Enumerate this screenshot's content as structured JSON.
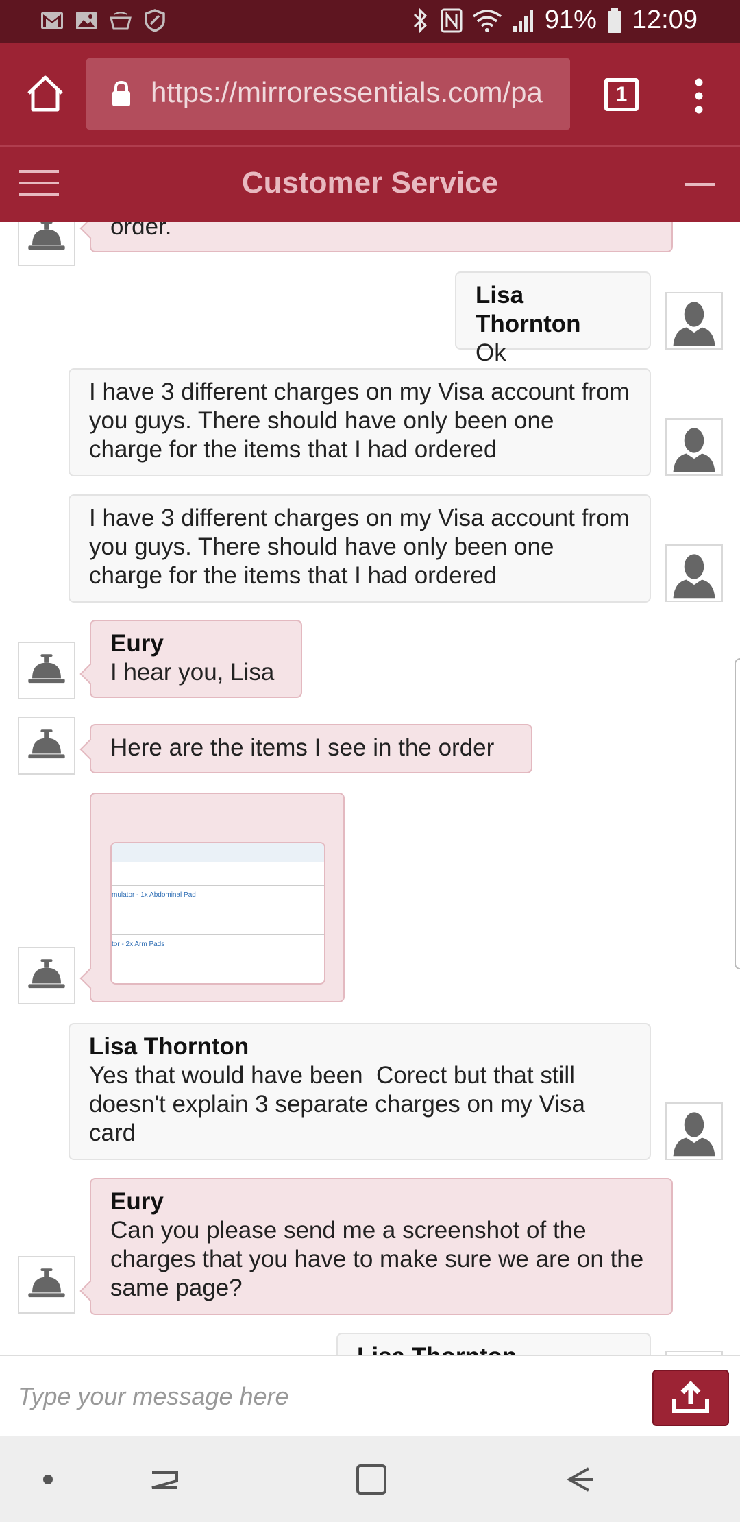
{
  "status_bar": {
    "left_icons": [
      "gmail-icon",
      "image-icon",
      "amazon-icon",
      "shield-icon"
    ],
    "right_icons": [
      "bluetooth-icon",
      "nfc-icon",
      "wifi-icon",
      "signal-icon"
    ],
    "battery": "91%",
    "time": "12:09"
  },
  "browser": {
    "url": "https://mirroressentials.com/pa",
    "tab_count": "1"
  },
  "header": {
    "title": "Customer Service"
  },
  "messages": [
    {
      "from": "agent",
      "sender": "",
      "text": "order."
    },
    {
      "from": "user",
      "sender": "Lisa Thornton",
      "text": "Ok"
    },
    {
      "from": "user",
      "sender": "",
      "text": "I have 3 different charges on my Visa account from you guys. There should have only been one charge for the items that I had ordered"
    },
    {
      "from": "user",
      "sender": "",
      "text": "I have 3 different charges on my Visa account from you guys. There should have only been one charge for the items that I had ordered"
    },
    {
      "from": "agent",
      "sender": "Eury",
      "text": "I hear you, Lisa"
    },
    {
      "from": "agent",
      "sender": "",
      "text": "Here are the items I see in the order"
    },
    {
      "from": "agent",
      "sender": "",
      "image_rows": [
        "mulator - 1x Abdominal Pad",
        "tor - 2x Arm Pads"
      ]
    },
    {
      "from": "user",
      "sender": "Lisa Thornton",
      "text": "Yes that would have been  Corect but that still doesn't explain 3 separate charges on my Visa card"
    },
    {
      "from": "agent",
      "sender": "Eury",
      "text": "Can you please send me a screenshot of the charges that you have to make sure we are on the same page?"
    },
    {
      "from": "user",
      "sender": "Lisa Thornton",
      "text": ""
    }
  ],
  "composer": {
    "placeholder": "Type your message here"
  },
  "colors": {
    "brand": "#9c2334",
    "status_bar": "#5e1520",
    "agent_bubble": "#f5e3e6",
    "user_bubble": "#f8f8f8"
  }
}
